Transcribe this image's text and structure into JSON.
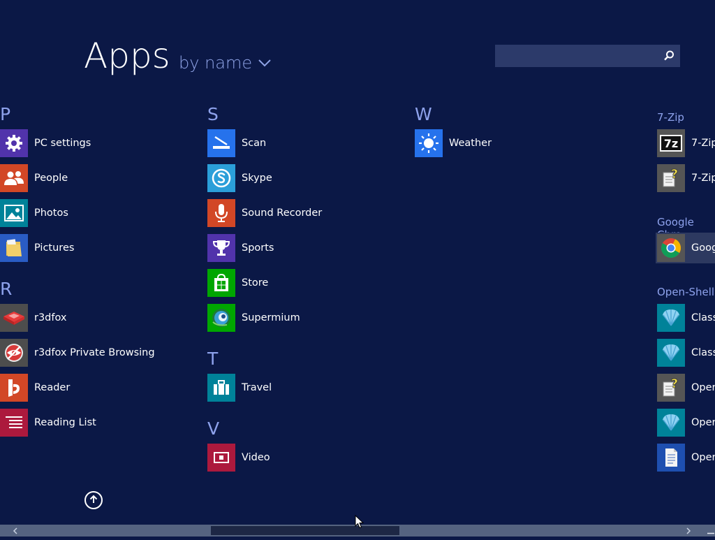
{
  "header": {
    "title": "Apps",
    "sort_label": "by name"
  },
  "search": {
    "placeholder": ""
  },
  "groups": {
    "p": "P",
    "r": "R",
    "s": "S",
    "t": "T",
    "v": "V",
    "w": "W",
    "sevenzip": "7-Zip",
    "chrome": "Google Chro",
    "openshell": "Open-Shell"
  },
  "apps": {
    "pc_settings": "PC settings",
    "people": "People",
    "photos": "Photos",
    "pictures": "Pictures",
    "r3dfox": "r3dfox",
    "r3dfox_private": "r3dfox Private Browsing",
    "reader": "Reader",
    "reading_list": "Reading List",
    "scan": "Scan",
    "skype": "Skype",
    "sound_recorder": "Sound Recorder",
    "sports": "Sports",
    "store": "Store",
    "supermium": "Supermium",
    "travel": "Travel",
    "video": "Video",
    "weather": "Weather",
    "sevenzip_1": "7-Zip",
    "sevenzip_2": "7-Zip",
    "chrome": "Goog",
    "classic_1": "Class",
    "classic_2": "Class",
    "open_1": "Oper",
    "open_2": "Oper",
    "open_3": "Oper"
  },
  "tiles": {
    "pc_settings": "#5133ab",
    "people": "#d24726",
    "photos": "#008299",
    "pictures": "#2a5cc4",
    "r3dfox": "#4d4d4d",
    "r3dfox_private": "#4d4d4d",
    "reader": "#d24726",
    "reading_list": "#ac193d",
    "scan": "#2672ec",
    "skype": "#2b9fd9",
    "sound_recorder": "#d24726",
    "sports": "#5133ab",
    "store": "#00a600",
    "supermium": "#00a600",
    "travel": "#008299",
    "video": "#ac193d",
    "weather": "#2672ec",
    "desktop_gray": "#555555",
    "desktop_teal": "#008299",
    "desktop_blue": "#1e4fb0"
  }
}
